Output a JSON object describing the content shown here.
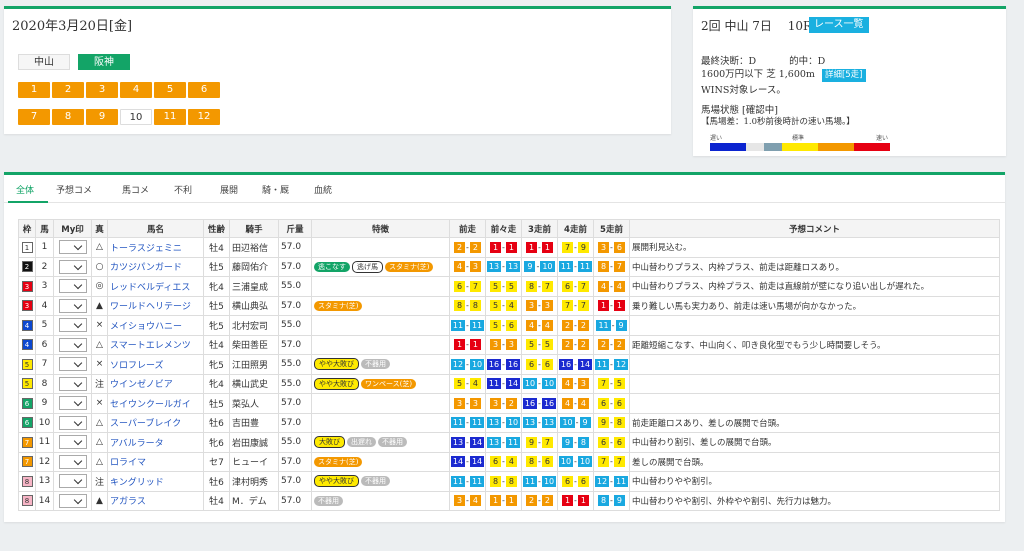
{
  "date_card": {
    "title": "2020年3月20日[金]",
    "venues": [
      {
        "label": "中山",
        "active": false
      },
      {
        "label": "阪神",
        "active": true
      }
    ],
    "races_row1": [
      "1",
      "2",
      "3",
      "4",
      "5",
      "6"
    ],
    "races_row2": [
      "7",
      "8",
      "9",
      "10",
      "11",
      "12"
    ],
    "current_race": "10"
  },
  "race_card": {
    "title": "2回 中山 7日",
    "race_no": "10R",
    "list_button": "レース一覧",
    "decision": "最終決断：D",
    "hit": "的中：D",
    "condition": "1600万円以下 芝 1,600m",
    "detail_button": "詳細[5走]",
    "wins": "WINS対象レース。",
    "track_status": "馬場状態 [確認中]",
    "track_diff": "【馬場差：1.0秒前後時計の速い馬場。】",
    "scale_labels": [
      "遅い",
      "標準",
      "速い"
    ],
    "scale_colors": [
      "#0b24d0",
      "#0b24d0",
      "#e6e6e6",
      "#7f9faf",
      "#ffe900",
      "#ffe900",
      "#f39800",
      "#f39800",
      "#e60012",
      "#e60012"
    ]
  },
  "tabs": [
    "全体",
    "予想コメ",
    "馬コメ",
    "不利",
    "展開",
    "騎・厩",
    "血統"
  ],
  "active_tab": "全体",
  "table": {
    "headers": [
      "枠",
      "馬",
      "My印",
      "真",
      "馬名",
      "性齢",
      "騎手",
      "斤量",
      "特徴",
      "前走",
      "前々走",
      "3走前",
      "4走前",
      "5走前",
      "予想コメント"
    ],
    "waku_colors": {
      "1": {
        "bg": "#ffffff",
        "fg": "#333333"
      },
      "2": {
        "bg": "#111111",
        "fg": "#ffffff"
      },
      "3": {
        "bg": "#e60012",
        "fg": "#ffffff"
      },
      "4": {
        "bg": "#0b47d0",
        "fg": "#ffffff"
      },
      "5": {
        "bg": "#ffe900",
        "fg": "#333333"
      },
      "6": {
        "bg": "#13a467",
        "fg": "#ffffff"
      },
      "7": {
        "bg": "#f39800",
        "fg": "#ffffff"
      },
      "8": {
        "bg": "#f7b5c6",
        "fg": "#333333"
      }
    },
    "pos_colors": {
      "y": {
        "bg": "#ffe900",
        "fg": "#333333"
      },
      "o": {
        "bg": "#f39800",
        "fg": "#ffffff"
      },
      "r": {
        "bg": "#e60012",
        "fg": "#ffffff"
      },
      "b": {
        "bg": "#1b2ad0",
        "fg": "#ffffff"
      },
      "c": {
        "bg": "#19a8e0",
        "fg": "#ffffff"
      }
    },
    "rows": [
      {
        "waku": "1",
        "uma": "1",
        "shin": "△",
        "name": "トーラスジェミニ",
        "sex": "牡4",
        "jockey": "田辺裕信",
        "weight": "57.0",
        "tags": [],
        "past": [
          [
            "2",
            "2",
            "o"
          ],
          [
            "1",
            "1",
            "r"
          ],
          [
            "1",
            "1",
            "r"
          ],
          [
            "7",
            "9",
            "y"
          ],
          [
            "3",
            "6",
            "o"
          ]
        ],
        "comment": "展開利見込む。"
      },
      {
        "waku": "2",
        "uma": "2",
        "shin": "○",
        "name": "カツジパンガード",
        "sex": "牡5",
        "jockey": "藤岡佑介",
        "weight": "57.0",
        "tags": [
          [
            "逃こなす",
            "green"
          ],
          [
            "逃げ馬",
            "white"
          ],
          [
            "スタミナ(芝)",
            "o"
          ]
        ],
        "past": [
          [
            "4",
            "3",
            "o"
          ],
          [
            "13",
            "13",
            "c"
          ],
          [
            "9",
            "10",
            "c"
          ],
          [
            "11",
            "11",
            "c"
          ],
          [
            "8",
            "7",
            "o"
          ]
        ],
        "comment": "中山替わりプラス、内枠プラス、前走は距離ロスあり。"
      },
      {
        "waku": "3",
        "uma": "3",
        "shin": "◎",
        "name": "レッドベルディエス",
        "sex": "牝4",
        "jockey": "三浦皇成",
        "weight": "55.0",
        "tags": [],
        "past": [
          [
            "6",
            "7",
            "y"
          ],
          [
            "5",
            "5",
            "y"
          ],
          [
            "8",
            "7",
            "y"
          ],
          [
            "6",
            "7",
            "y"
          ],
          [
            "4",
            "4",
            "o"
          ]
        ],
        "comment": "中山替わりプラス、内枠プラス、前走は直線前が壁になり追い出しが遅れた。"
      },
      {
        "waku": "3",
        "uma": "4",
        "shin": "▲",
        "name": "ワールドヘリテージ",
        "sex": "牡5",
        "jockey": "横山典弘",
        "weight": "57.0",
        "tags": [
          [
            "スタミナ(芝)",
            "o"
          ]
        ],
        "past": [
          [
            "8",
            "8",
            "y"
          ],
          [
            "5",
            "4",
            "y"
          ],
          [
            "3",
            "3",
            "o"
          ],
          [
            "7",
            "7",
            "y"
          ],
          [
            "1",
            "1",
            "r"
          ]
        ],
        "comment": "乗り難しい馬も実力あり、前走は速い馬場が向かなかった。"
      },
      {
        "waku": "4",
        "uma": "5",
        "shin": "×",
        "name": "メイショウハニー",
        "sex": "牝5",
        "jockey": "北村宏司",
        "weight": "55.0",
        "tags": [],
        "past": [
          [
            "11",
            "11",
            "c"
          ],
          [
            "5",
            "6",
            "y"
          ],
          [
            "4",
            "4",
            "o"
          ],
          [
            "2",
            "2",
            "o"
          ],
          [
            "11",
            "9",
            "c"
          ]
        ],
        "comment": ""
      },
      {
        "waku": "4",
        "uma": "6",
        "shin": "△",
        "name": "スマートエレメンツ",
        "sex": "牡4",
        "jockey": "柴田善臣",
        "weight": "57.0",
        "tags": [],
        "past": [
          [
            "1",
            "1",
            "r"
          ],
          [
            "3",
            "3",
            "o"
          ],
          [
            "5",
            "5",
            "y"
          ],
          [
            "2",
            "2",
            "o"
          ],
          [
            "2",
            "2",
            "o"
          ]
        ],
        "comment": "距離短縮こなす、中山向く、叩き良化型でもう少し時間要しそう。"
      },
      {
        "waku": "5",
        "uma": "7",
        "shin": "×",
        "name": "ソロフレーズ",
        "sex": "牝5",
        "jockey": "江田照男",
        "weight": "55.0",
        "tags": [
          [
            "やや大敗び",
            "yellow"
          ],
          [
            "不器用",
            "gray"
          ]
        ],
        "past": [
          [
            "12",
            "10",
            "c"
          ],
          [
            "16",
            "16",
            "b"
          ],
          [
            "6",
            "6",
            "y"
          ],
          [
            "16",
            "14",
            "b"
          ],
          [
            "11",
            "12",
            "c"
          ]
        ],
        "comment": ""
      },
      {
        "waku": "5",
        "uma": "8",
        "shin": "注",
        "name": "ウインゼノビア",
        "sex": "牝4",
        "jockey": "横山武史",
        "weight": "55.0",
        "tags": [
          [
            "やや大敗び",
            "yellow"
          ],
          [
            "ワンペース(芝)",
            "o"
          ]
        ],
        "past": [
          [
            "5",
            "4",
            "y"
          ],
          [
            "11",
            "14",
            "b"
          ],
          [
            "10",
            "10",
            "c"
          ],
          [
            "4",
            "3",
            "o"
          ],
          [
            "7",
            "5",
            "y"
          ]
        ],
        "comment": ""
      },
      {
        "waku": "6",
        "uma": "9",
        "shin": "×",
        "name": "セイウンクールガイ",
        "sex": "牡5",
        "jockey": "菜弘人",
        "weight": "57.0",
        "tags": [],
        "past": [
          [
            "3",
            "3",
            "o"
          ],
          [
            "3",
            "2",
            "o"
          ],
          [
            "16",
            "16",
            "b"
          ],
          [
            "4",
            "4",
            "o"
          ],
          [
            "6",
            "6",
            "y"
          ]
        ],
        "comment": ""
      },
      {
        "waku": "6",
        "uma": "10",
        "shin": "△",
        "name": "スーパーブレイク",
        "sex": "牡6",
        "jockey": "吉田豊",
        "weight": "57.0",
        "tags": [],
        "past": [
          [
            "11",
            "11",
            "c"
          ],
          [
            "13",
            "10",
            "c"
          ],
          [
            "13",
            "13",
            "c"
          ],
          [
            "10",
            "9",
            "c"
          ],
          [
            "9",
            "8",
            "y"
          ]
        ],
        "comment": "前走距離ロスあり、差しの展開で台頭。"
      },
      {
        "waku": "7",
        "uma": "11",
        "shin": "△",
        "name": "アバルラータ",
        "sex": "牝6",
        "jockey": "岩田康誠",
        "weight": "55.0",
        "tags": [
          [
            "大敗び",
            "yellow"
          ],
          [
            "出遅れ",
            "gray"
          ],
          [
            "不器用",
            "gray"
          ]
        ],
        "past": [
          [
            "13",
            "14",
            "b"
          ],
          [
            "13",
            "11",
            "c"
          ],
          [
            "9",
            "7",
            "y"
          ],
          [
            "9",
            "8",
            "c"
          ],
          [
            "6",
            "6",
            "y"
          ]
        ],
        "comment": "中山替わり割引、差しの展開で台頭。"
      },
      {
        "waku": "7",
        "uma": "12",
        "shin": "△",
        "name": "ロライマ",
        "sex": "セ7",
        "jockey": "ヒューイ",
        "weight": "57.0",
        "tags": [
          [
            "スタミナ(芝)",
            "o"
          ]
        ],
        "past": [
          [
            "14",
            "14",
            "b"
          ],
          [
            "6",
            "4",
            "y"
          ],
          [
            "8",
            "6",
            "y"
          ],
          [
            "10",
            "10",
            "c"
          ],
          [
            "7",
            "7",
            "y"
          ]
        ],
        "comment": "差しの展開で台頭。"
      },
      {
        "waku": "8",
        "uma": "13",
        "shin": "注",
        "name": "キングリッド",
        "sex": "牡6",
        "jockey": "津村明秀",
        "weight": "57.0",
        "tags": [
          [
            "やや大敗び",
            "yellow"
          ],
          [
            "不器用",
            "gray"
          ]
        ],
        "past": [
          [
            "11",
            "11",
            "c"
          ],
          [
            "8",
            "8",
            "y"
          ],
          [
            "11",
            "10",
            "c"
          ],
          [
            "6",
            "6",
            "y"
          ],
          [
            "12",
            "11",
            "c"
          ]
        ],
        "comment": "中山替わりやや割引。"
      },
      {
        "waku": "8",
        "uma": "14",
        "shin": "▲",
        "name": "アガラス",
        "sex": "牡4",
        "jockey": "M．デム",
        "weight": "57.0",
        "tags": [
          [
            "不器用",
            "gray"
          ]
        ],
        "past": [
          [
            "3",
            "4",
            "o"
          ],
          [
            "1",
            "1",
            "o"
          ],
          [
            "2",
            "2",
            "o"
          ],
          [
            "1",
            "1",
            "r"
          ],
          [
            "8",
            "9",
            "c"
          ]
        ],
        "comment": "中山替わりやや割引、外枠やや割引、先行力は魅力。"
      }
    ]
  }
}
